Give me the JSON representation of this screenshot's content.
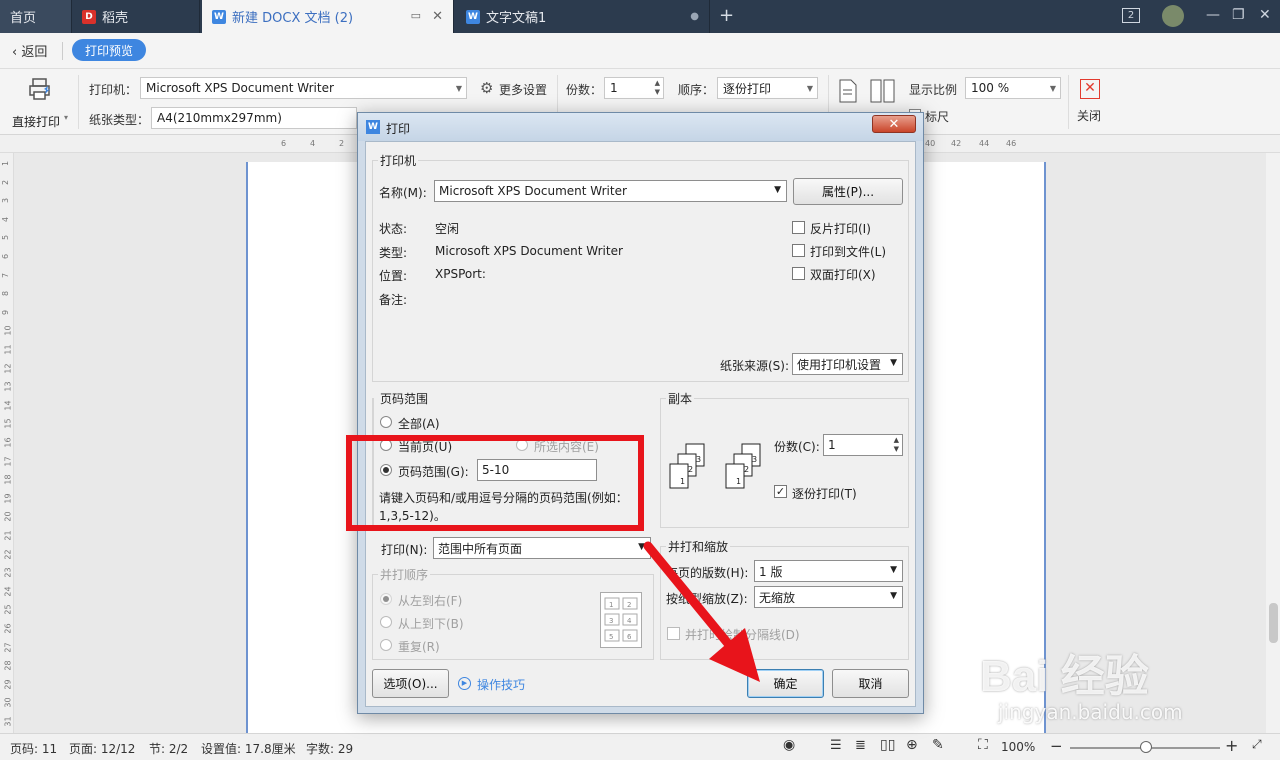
{
  "tabs": [
    {
      "label": "首页"
    },
    {
      "label": "稻壳"
    },
    {
      "label": "新建 DOCX 文档 (2)"
    },
    {
      "label": "文字文稿1"
    }
  ],
  "topbar": {
    "window_count": "2"
  },
  "toolbar": {
    "back_label": "返回",
    "preview_badge": "打印预览",
    "direct_print_label": "直接打印",
    "printer_label": "打印机：",
    "printer_value": "Microsoft XPS Document Writer",
    "more_settings_label": "更多设置",
    "paper_type_label": "纸张类型：",
    "paper_type_value": "A4(210mmx297mm)",
    "copies_label": "份数：",
    "copies_value": "1",
    "order_label": "顺序：",
    "order_value": "逐份打印",
    "zoom_label": "显示比例",
    "zoom_value": "100 %",
    "ruler_label": "标尺",
    "close_label": "关闭"
  },
  "ruler_numbers": [
    "6",
    "4",
    "2",
    "40",
    "42",
    "44",
    "46"
  ],
  "vruler_numbers": [
    "1",
    "2",
    "3",
    "4",
    "5",
    "6",
    "7",
    "8",
    "9",
    "10",
    "11",
    "12",
    "13",
    "14",
    "15",
    "16",
    "17",
    "18",
    "19",
    "20",
    "21",
    "22",
    "23",
    "24",
    "25",
    "26",
    "27",
    "28",
    "29",
    "30",
    "31"
  ],
  "dialog": {
    "title": "打印",
    "printer_group": "打印机",
    "name_label": "名称(M):",
    "name_value": "Microsoft XPS Document Writer",
    "properties_button": "属性(P)...",
    "status_label": "状态:",
    "status_value": "空闲",
    "type_label": "类型:",
    "type_value": "Microsoft XPS Document Writer",
    "location_label": "位置:",
    "location_value": "XPSPort:",
    "comment_label": "备注:",
    "reverse_print": "反片打印(I)",
    "print_to_file": "打印到文件(L)",
    "duplex_print": "双面打印(X)",
    "paper_source_label": "纸张来源(S):",
    "paper_source_value": "使用打印机设置",
    "page_range_group": "页码范围",
    "all_label": "全部(A)",
    "current_page_label": "当前页(U)",
    "selection_label": "所选内容(E)",
    "page_range_label": "页码范围(G):",
    "page_range_value": "5-10",
    "hint_line1": "请键入页码和/或用逗号分隔的页码范围(例如：",
    "hint_line2": "1,3,5-12)。",
    "copies_group": "副本",
    "copies_label": "份数(C):",
    "copies_value": "1",
    "collate_label": "逐份打印(T)",
    "print_label": "打印(N):",
    "print_value": "范围中所有页面",
    "order_group": "并打顺序",
    "order_ltr": "从左到右(F)",
    "order_ttb": "从上到下(B)",
    "order_repeat": "重复(R)",
    "scale_group": "并打和缩放",
    "pages_per_sheet_label": "每页的版数(H):",
    "pages_per_sheet_value": "1 版",
    "scale_paper_label": "按纸型缩放(Z):",
    "scale_paper_value": "无缩放",
    "divider_label": "并打时绘制分隔线(D)",
    "options_button": "选项(O)...",
    "tips_link": "操作技巧",
    "ok_button": "确定",
    "cancel_button": "取消"
  },
  "statusbar": {
    "page_no": "页码: 11",
    "page_count": "页面: 12/12",
    "section": "节: 2/2",
    "setting": "设置值: 17.8厘米",
    "words": "字数: 29",
    "zoom": "100%"
  },
  "watermark": {
    "logo": "Bai 经验",
    "url": "jingyan.baidu.com"
  },
  "colors": {
    "accent": "#3e86e0",
    "highlight_red": "#e8141b",
    "tabbar": "#2c3b4e"
  }
}
